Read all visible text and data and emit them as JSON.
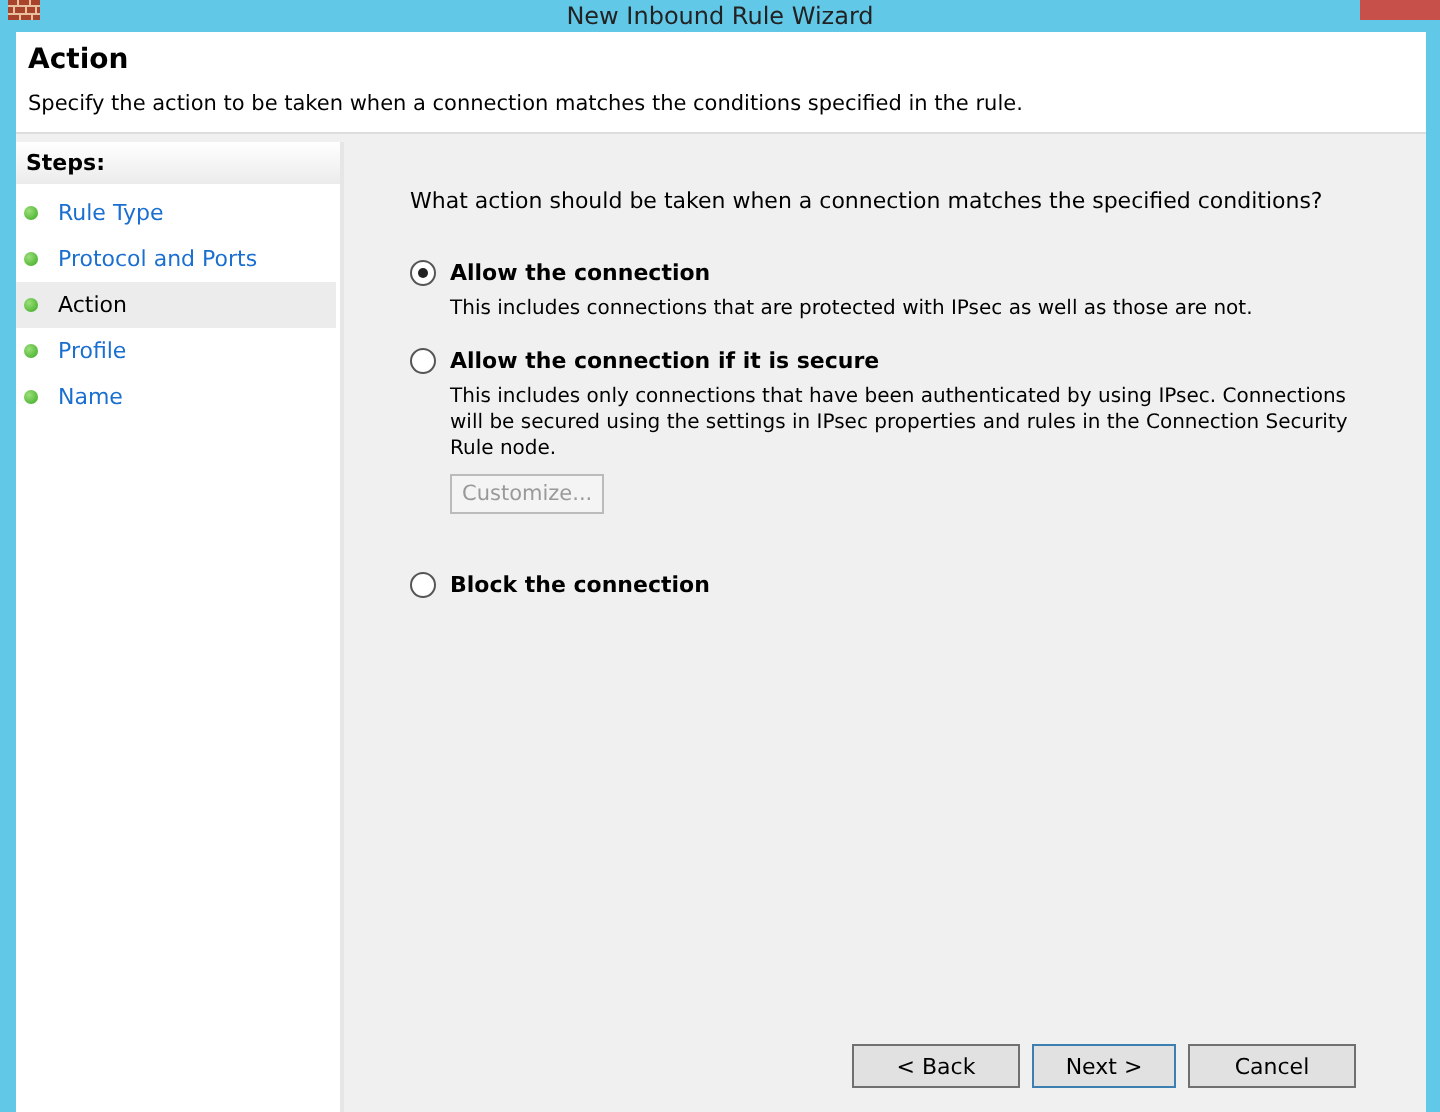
{
  "window": {
    "title": "New Inbound Rule Wizard"
  },
  "header": {
    "title": "Action",
    "description": "Specify the action to be taken when a connection matches the conditions specified in the rule."
  },
  "steps": {
    "heading": "Steps:",
    "items": [
      {
        "label": "Rule Type",
        "selected": false
      },
      {
        "label": "Protocol and Ports",
        "selected": false
      },
      {
        "label": "Action",
        "selected": true
      },
      {
        "label": "Profile",
        "selected": false
      },
      {
        "label": "Name",
        "selected": false
      }
    ]
  },
  "question": "What action should be taken when a connection matches the specified conditions?",
  "options": [
    {
      "label": "Allow the connection",
      "selected": true,
      "description": "This includes connections that are protected with IPsec as well as those are not."
    },
    {
      "label": "Allow the connection if it is secure",
      "selected": false,
      "description": "This includes only connections that have been authenticated by using IPsec.  Connections will be secured using the settings in IPsec properties and rules in the Connection Security Rule node.",
      "button": {
        "label": "Customize...",
        "disabled": true
      }
    },
    {
      "label": "Block the connection",
      "selected": false
    }
  ],
  "buttons": [
    {
      "label": "< Back",
      "default": false
    },
    {
      "label": "Next >",
      "default": true
    },
    {
      "label": "Cancel",
      "default": false
    }
  ]
}
